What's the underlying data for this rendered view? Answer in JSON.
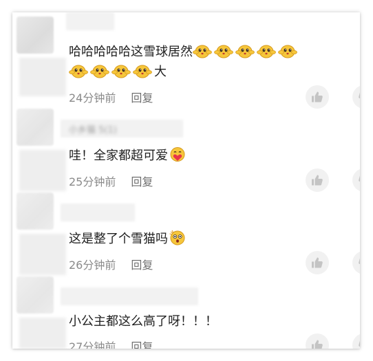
{
  "comments": [
    {
      "text": "哈哈哈哈哈这雪球居然",
      "tail": "大",
      "emoji_count_line1": 5,
      "emoji_count_line2": 4,
      "time": "24分钟前",
      "reply": "回复"
    },
    {
      "username_blurred": "小乡猫 5(1)",
      "text": "哇！全家都超可爱",
      "emoji": "heart-hug-emoji",
      "time": "25分钟前",
      "reply": "回复"
    },
    {
      "text": "这是整了个雪猫吗",
      "emoji": "astonished-emoji",
      "time": "26分钟前",
      "reply": "回复"
    },
    {
      "text": "小公主都这么高了呀！！！",
      "time": "27分钟前",
      "reply": "回复"
    }
  ],
  "icons": {
    "like": "thumbs-up-icon",
    "dislike": "thumbs-down-icon"
  },
  "colors": {
    "text": "#1f1f1f",
    "meta": "#8a8a8a",
    "action_bg": "#f1f1f1",
    "action_icon": "#c4c4c4",
    "emoji_yellow": "#f6c63b"
  }
}
